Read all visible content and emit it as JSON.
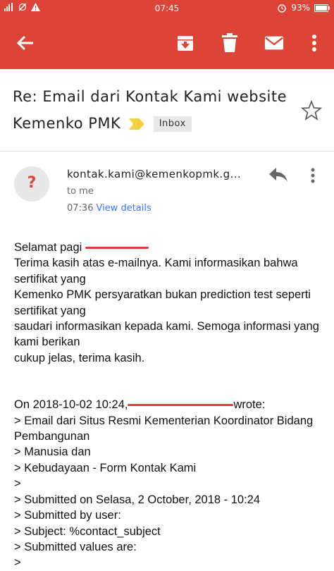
{
  "status_bar": {
    "time": "07:45",
    "battery": "93%",
    "colors": {
      "background": "#db4437",
      "text": "#ffffff"
    }
  },
  "app_bar": {
    "icons": [
      "back-arrow-icon",
      "archive-icon",
      "delete-icon",
      "mark-unread-icon",
      "more-vert-icon"
    ],
    "color": "#db4437"
  },
  "email": {
    "subject": "Re: Email dari Kontak Kami website Kemenko PMK",
    "label": "Inbox",
    "sender": "kontak.kami@kemenkopmk.g...",
    "to": "to me",
    "time": "07:36",
    "view_details": "View details",
    "avatar_letter": "?"
  },
  "body": {
    "greeting": "Selamat pagi",
    "paragraph": "Terima kasih atas e-mailnya. Kami informasikan bahwa sertifikat yang\nKemenko PMK persyaratkan bukan prediction test seperti sertifikat yang\nsaudari informasikan kepada kami. Semoga informasi yang kami berikan\ncukup jelas, terima kasih.",
    "quote_header_start": "On 2018-10-02 10:24,",
    "quote_header_end": "wrote:",
    "quoted": "> Email dari Situs Resmi Kementerian Koordinator Bidang Pembangunan\n> Manusia dan\n> Kebudayaan - Form Kontak Kami\n>\n> Submitted on Selasa, 2 October, 2018 - 10:24\n> Submitted by user:\n> Subject: %contact_subject\n> Submitted values are:\n>"
  }
}
